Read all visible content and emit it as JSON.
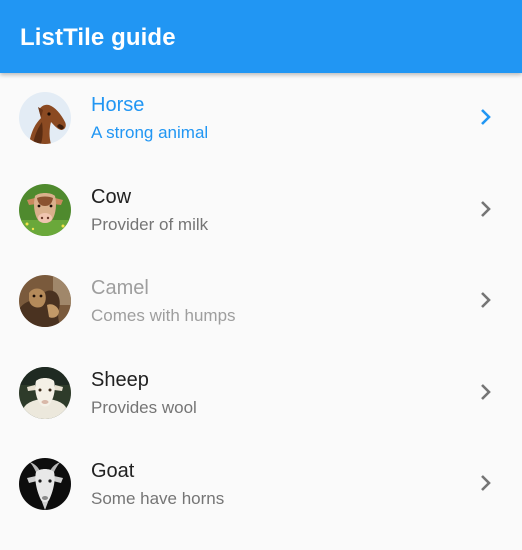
{
  "app_bar": {
    "title": "ListTile guide",
    "color": "#2196f3"
  },
  "list": {
    "items": [
      {
        "title": "Horse",
        "subtitle": "A strong animal",
        "state": "selected",
        "avatar": "horse-avatar",
        "trailing_icon": "chevron-right-icon"
      },
      {
        "title": "Cow",
        "subtitle": "Provider of milk",
        "state": "normal",
        "avatar": "cow-avatar",
        "trailing_icon": "chevron-right-icon"
      },
      {
        "title": "Camel",
        "subtitle": "Comes with humps",
        "state": "disabled",
        "avatar": "camel-avatar",
        "trailing_icon": "chevron-right-icon"
      },
      {
        "title": "Sheep",
        "subtitle": "Provides wool",
        "state": "normal",
        "avatar": "sheep-avatar",
        "trailing_icon": "chevron-right-icon"
      },
      {
        "title": "Goat",
        "subtitle": "Some have horns",
        "state": "normal",
        "avatar": "goat-avatar",
        "trailing_icon": "chevron-right-icon"
      }
    ]
  },
  "colors": {
    "selected": "#2196f3",
    "title": "#212121",
    "subtitle": "#757575",
    "disabled": "#9e9e9e",
    "chevron": "#757575"
  }
}
